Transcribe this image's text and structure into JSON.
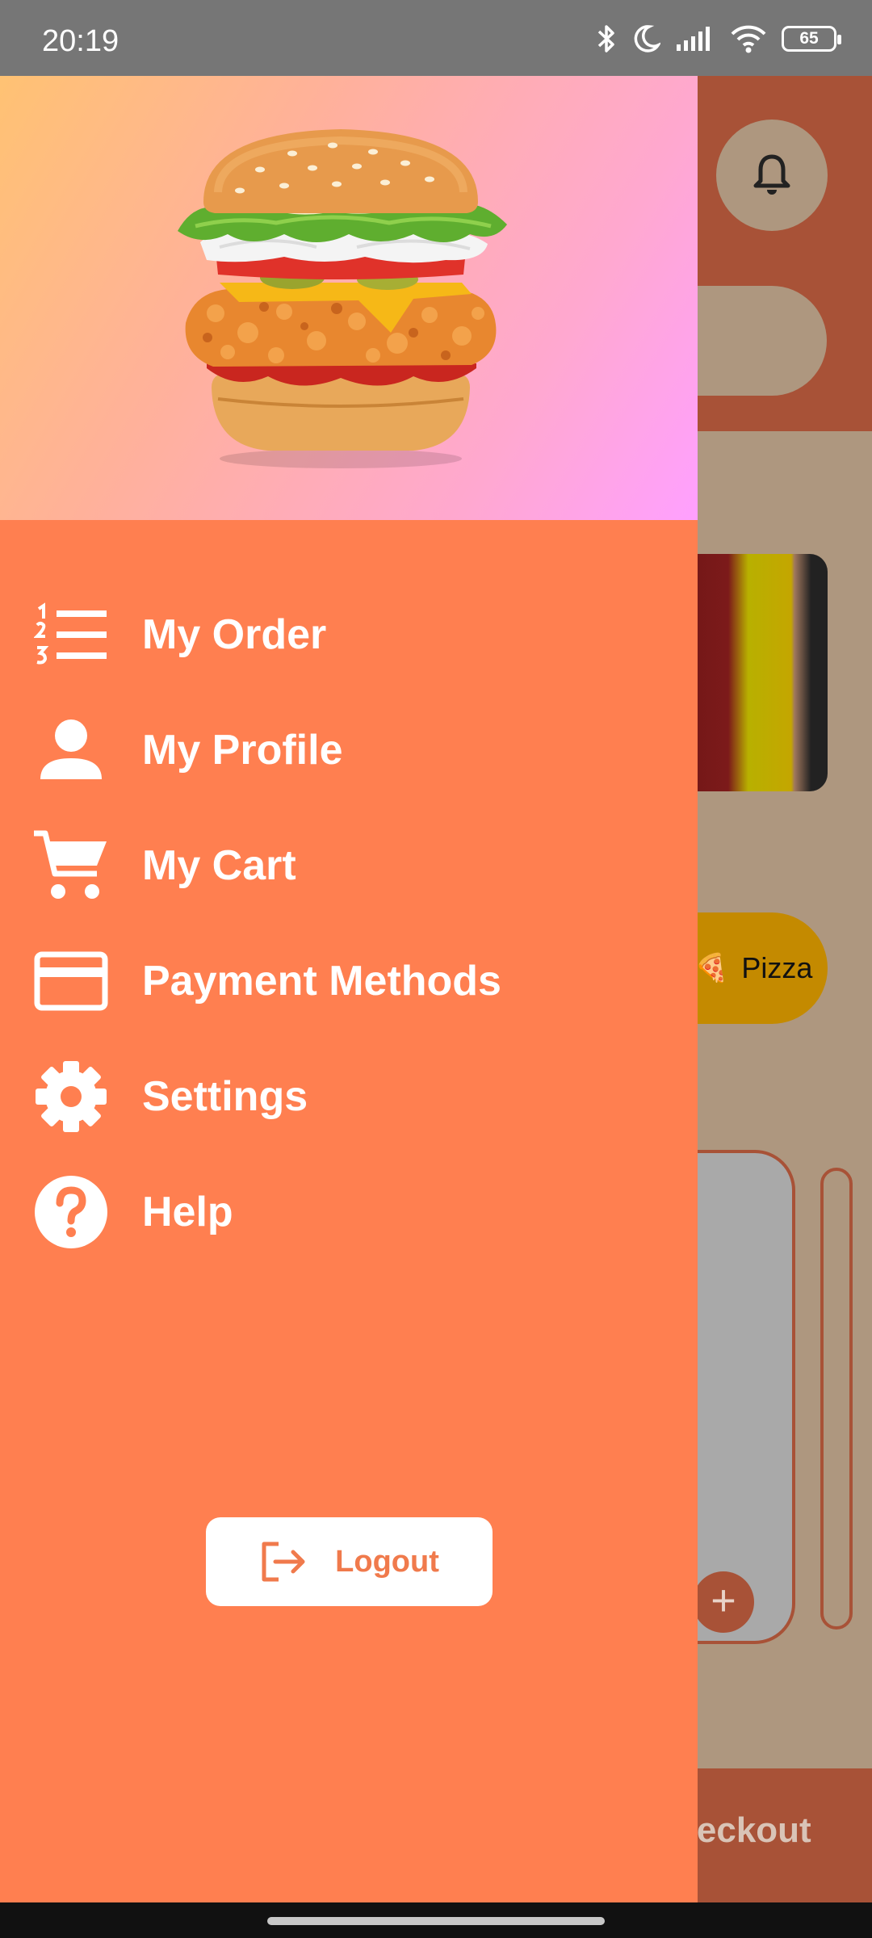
{
  "status_bar": {
    "time": "20:19",
    "battery": "65",
    "icons": [
      "bluetooth-icon",
      "moon-icon",
      "signal-icon",
      "wifi-icon",
      "battery-icon"
    ]
  },
  "background_app": {
    "category_chip": "Pizza",
    "checkout_label": "heckout",
    "add_label": "+"
  },
  "drawer": {
    "menu": [
      {
        "label": "My Order",
        "icon": "order-list-icon"
      },
      {
        "label": "My Profile",
        "icon": "person-icon"
      },
      {
        "label": "My Cart",
        "icon": "cart-icon"
      },
      {
        "label": "Payment Methods",
        "icon": "credit-card-icon"
      },
      {
        "label": "Settings",
        "icon": "gear-icon"
      },
      {
        "label": "Help",
        "icon": "help-icon"
      }
    ],
    "logout_label": "Logout"
  },
  "colors": {
    "drawer": "#ff7f50",
    "accent": "#f07a4c",
    "status_bar": "#767676"
  }
}
